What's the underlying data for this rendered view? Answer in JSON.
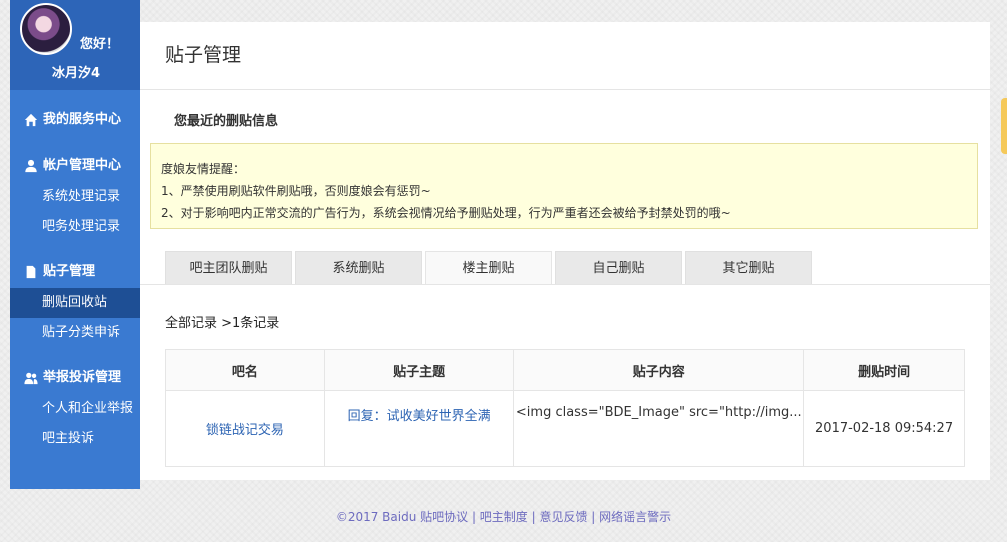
{
  "user": {
    "greeting": "您好！",
    "name": "冰月汐4"
  },
  "sidebar": {
    "sections": [
      {
        "label": "我的服务中心",
        "icon": "home-icon",
        "items": []
      },
      {
        "label": "帐户管理中心",
        "icon": "user-icon",
        "items": [
          "系统处理记录",
          "吧务处理记录"
        ]
      },
      {
        "label": "贴子管理",
        "icon": "document-icon",
        "items": [
          "删贴回收站",
          "贴子分类申诉"
        ]
      },
      {
        "label": "举报投诉管理",
        "icon": "users-icon",
        "items": [
          "个人和企业举报",
          "吧主投诉"
        ]
      }
    ],
    "active_item": "删贴回收站"
  },
  "page": {
    "title": "贴子管理",
    "section_title": "您最近的删贴信息"
  },
  "notice": {
    "heading": "度娘友情提醒：",
    "line1": "1、严禁使用刷贴软件刷贴哦，否则度娘会有惩罚~",
    "line2": "2、对于影响吧内正常交流的广告行为，系统会视情况给予删贴处理，行为严重者还会被给予封禁处罚的哦~"
  },
  "tabs": [
    "吧主团队删贴",
    "系统删贴",
    "楼主删贴",
    "自己删贴",
    "其它删贴"
  ],
  "active_tab": "楼主删贴",
  "records": {
    "label": "全部记录 >1条记录"
  },
  "table": {
    "headers": [
      "吧名",
      "贴子主题",
      "贴子内容",
      "删贴时间"
    ],
    "rows": [
      {
        "bar": "锁链战记交易",
        "topic": "回复：试收美好世界全满",
        "content": "<img class=\"BDE_Image\" src=\"http://img...",
        "time": "2017-02-18 09:54:27"
      }
    ]
  },
  "footer": {
    "text": "©2017 Baidu 贴吧协议 | 吧主制度 | 意见反馈 | 网络谣言警示"
  },
  "colors": {
    "sidebar": "#3a7ad1",
    "sidebar_active": "#1e4f95",
    "link": "#2d64b3",
    "notice_bg": "#ffffdd"
  }
}
